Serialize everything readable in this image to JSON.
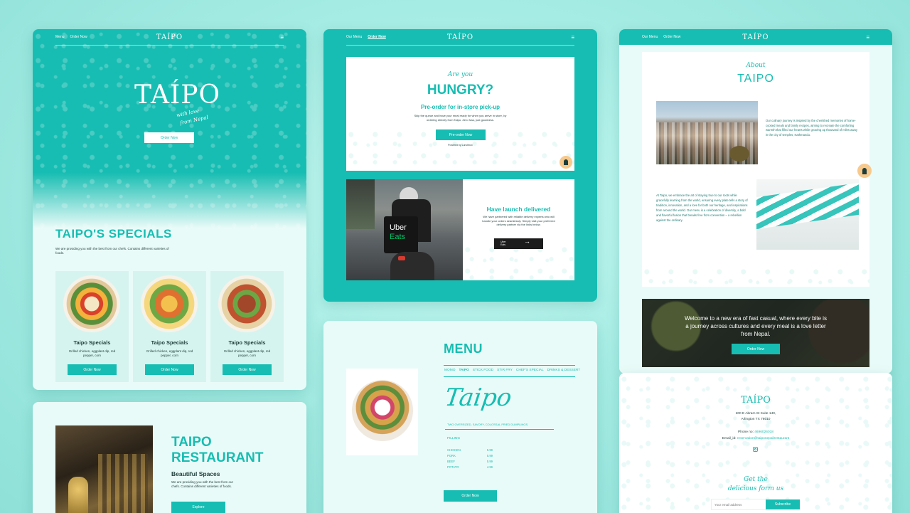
{
  "panel1": {
    "nav": {
      "link1": "Menu",
      "link2": "Order Now",
      "brand": "TAÍPO",
      "burger": "≡"
    },
    "hero": {
      "logo": "TAÍPO",
      "tagline1": "with love",
      "tagline2": "from Nepal",
      "cta": "Order Now"
    },
    "specials": {
      "title": "TAIPO'S SPECIALS",
      "desc": "We are providing you with the best from our chefs. Contains different varieties of foods.",
      "items": [
        {
          "name": "Taipo Specials",
          "desc": "Grilled chicken, eggplant dip, red pepper, corn",
          "cta": "Order Now"
        },
        {
          "name": "Taipo Specials",
          "desc": "Grilled chicken, eggplant dip, red pepper, corn",
          "cta": "Order Now"
        },
        {
          "name": "Taipo Specials",
          "desc": "Grilled chicken, eggplant dip, red pepper, corn",
          "cta": "Order Now"
        }
      ]
    }
  },
  "panel2": {
    "title1": "TAIPO",
    "title2": "RESTAURANT",
    "subtitle": "Beautiful Spaces",
    "desc": "We are providing you with the best from our chefs. Contains different varieties of foods.",
    "cta": "Explore"
  },
  "panel3": {
    "nav": {
      "link1": "Our Menu",
      "link2": "Order Now",
      "brand": "TAÍPO",
      "burger": "≡"
    },
    "hungry": {
      "script": "Are you",
      "title": "HUNGRY?",
      "subtitle": "Pre-order for in-store pick-up",
      "desc": "Skip the queue and have your meal ready for when you arrive in store, by ordering directly from Taipo. Zero fuss, just goodness.",
      "cta": "Pre-order Now",
      "powered": "Powered by  Lunchbox"
    },
    "launch": {
      "bag_line1": "Uber",
      "bag_line2": "Eats",
      "title": "Have launch delivered",
      "desc": "We have partnered with reliable delivery experts who will handle your orders seamlessly. Simply visit your preferred delivery partner via the links below.",
      "btn_line1": "Uber",
      "btn_line2": "Eats",
      "arrow": "→"
    }
  },
  "panel4": {
    "title": "MENU",
    "tabs": [
      "MOMO",
      "TAIPO",
      "STICK FOOD",
      "STIR FRY",
      "CHEF'S SPECIAL",
      "DRINKS & DESSERT"
    ],
    "script": "Taipo",
    "desc": "TWO OVERSIZED, SAVORY, COLOSSAL FRIED DUMPLINGS.",
    "filling_label": "FILLING",
    "fillings": [
      {
        "name": "CHICKEN",
        "price": "5.99"
      },
      {
        "name": "PORK",
        "price": "5.99"
      },
      {
        "name": "BEEF",
        "price": "5.99"
      },
      {
        "name": "POTATO",
        "price": "4.99"
      }
    ],
    "cta": "Order Now"
  },
  "panel5": {
    "nav": {
      "link1": "Our Menu",
      "link2": "Order Now",
      "brand": "TAÍPO",
      "burger": "≡"
    },
    "about": {
      "script": "About",
      "title": "TAIPO",
      "para1": "Our culinary journey is inspired by the cherished memories of home-cooked meals and family recipes, aiming to recreate the comforting warmth that filled our hearts while growing up thousand of miles away in the city of temples, Kathmandu.",
      "para2": "At Taipo, we embrace the art of staying true to our roots while gracefully learning from the world, ensuring every plate tells a story of tradition, innovation, and a love for both our heritage, and inspirations from around the world. Our menu is a celebration of diversity, a bold and flavorful fusion that breaks free from convention – a rebellion against the ordinary."
    },
    "banner": {
      "text": "Welcome to a new era of fast casual, where every bite is a journey across cultures and every meal is a love letter from Nepal.",
      "cta": "Order Now"
    }
  },
  "panel6": {
    "brand": "TAÍPO",
    "address1": "200 E Abram St Suite 140,",
    "address2": "Arlington TX 76010",
    "phone_label": "Phone no:",
    "phone": "4696026018",
    "email_label": "Email_id:",
    "email": "reservation@taiponepalirestaurant",
    "script1": "Get the",
    "script2": "delicious form us",
    "email_placeholder": "Your email address",
    "subscribe": "Subscribe"
  },
  "colors": {
    "accent": "#17bdb2",
    "dark": "#1d3d3a"
  }
}
